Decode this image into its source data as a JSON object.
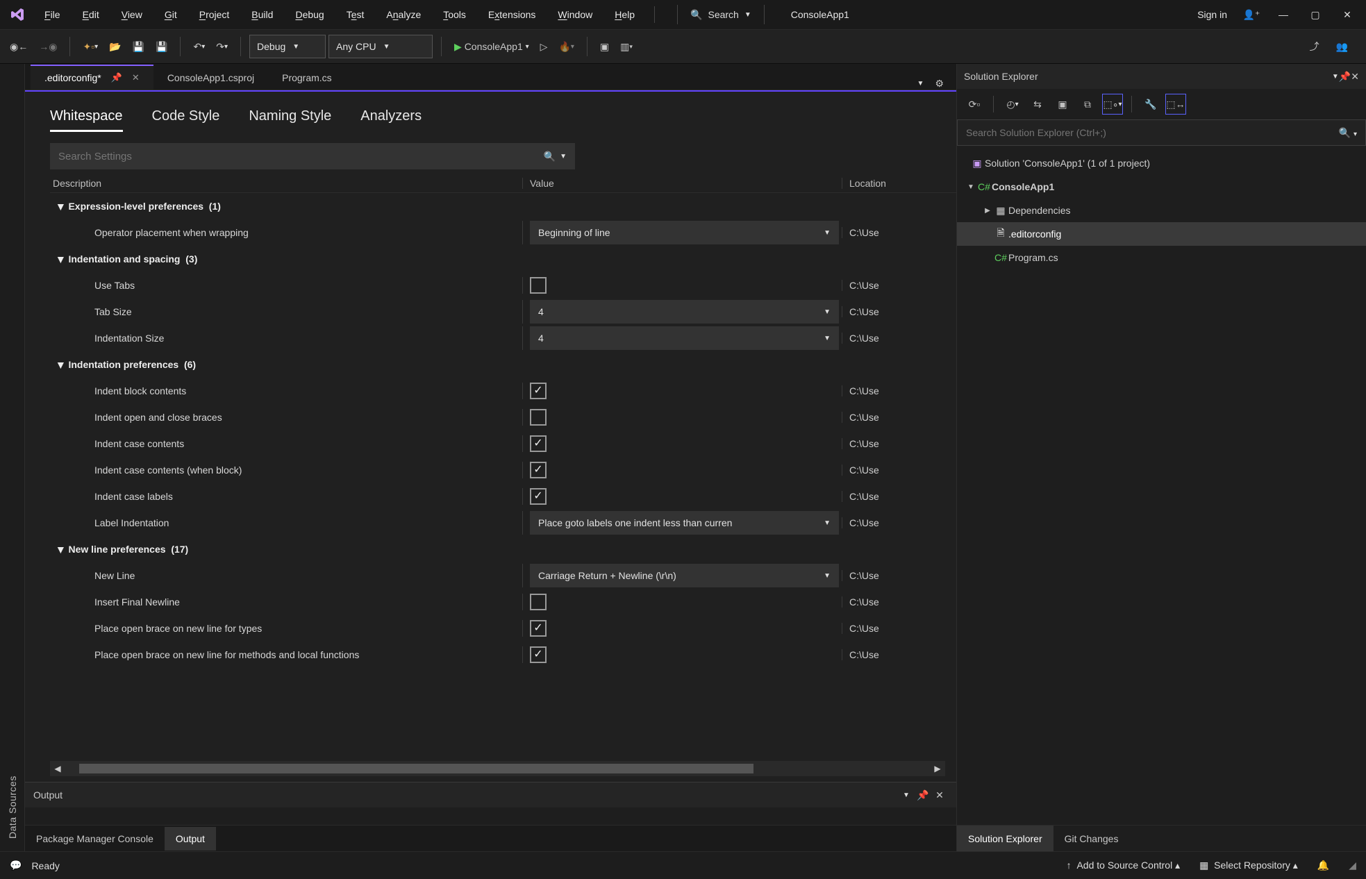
{
  "title_app": "ConsoleApp1",
  "menu": {
    "file": "File",
    "edit": "Edit",
    "view": "View",
    "git": "Git",
    "project": "Project",
    "build": "Build",
    "debug": "Debug",
    "test": "Test",
    "analyze": "Analyze",
    "tools": "Tools",
    "extensions": "Extensions",
    "window": "Window",
    "help": "Help"
  },
  "search_label": "Search",
  "signin": "Sign in",
  "toolbar": {
    "config": "Debug",
    "platform": "Any CPU",
    "start": "ConsoleApp1"
  },
  "left_pane_label": "Data Sources",
  "tabs": [
    {
      "label": ".editorconfig*",
      "active": true,
      "pinned": true,
      "closable": true
    },
    {
      "label": "ConsoleApp1.csproj",
      "active": false
    },
    {
      "label": "Program.cs",
      "active": false
    }
  ],
  "editorconfig": {
    "subtabs": [
      "Whitespace",
      "Code Style",
      "Naming Style",
      "Analyzers"
    ],
    "active_subtab": "Whitespace",
    "search_placeholder": "Search Settings",
    "columns": {
      "desc": "Description",
      "value": "Value",
      "loc": "Location"
    },
    "location_short": "C:\\Use",
    "groups": [
      {
        "title": "Expression-level preferences",
        "count": "(1)",
        "items": [
          {
            "desc": "Operator placement when wrapping",
            "kind": "dropdown",
            "value": "Beginning of line"
          }
        ]
      },
      {
        "title": "Indentation and spacing",
        "count": "(3)",
        "items": [
          {
            "desc": "Use Tabs",
            "kind": "checkbox",
            "checked": false
          },
          {
            "desc": "Tab Size",
            "kind": "dropdown",
            "value": "4"
          },
          {
            "desc": "Indentation Size",
            "kind": "dropdown",
            "value": "4"
          }
        ]
      },
      {
        "title": "Indentation preferences",
        "count": "(6)",
        "items": [
          {
            "desc": "Indent block contents",
            "kind": "checkbox",
            "checked": true
          },
          {
            "desc": "Indent open and close braces",
            "kind": "checkbox",
            "checked": false
          },
          {
            "desc": "Indent case contents",
            "kind": "checkbox",
            "checked": true
          },
          {
            "desc": "Indent case contents (when block)",
            "kind": "checkbox",
            "checked": true
          },
          {
            "desc": "Indent case labels",
            "kind": "checkbox",
            "checked": true
          },
          {
            "desc": "Label Indentation",
            "kind": "dropdown",
            "value": "Place goto labels one indent less than curren"
          }
        ]
      },
      {
        "title": "New line preferences",
        "count": "(17)",
        "items": [
          {
            "desc": "New Line",
            "kind": "dropdown",
            "value": "Carriage Return + Newline (\\r\\n)"
          },
          {
            "desc": "Insert Final Newline",
            "kind": "checkbox",
            "checked": false
          },
          {
            "desc": "Place open brace on new line for types",
            "kind": "checkbox",
            "checked": true
          },
          {
            "desc": "Place open brace on new line for methods and local functions",
            "kind": "checkbox",
            "checked": true
          }
        ]
      }
    ]
  },
  "output": {
    "title": "Output"
  },
  "bottom_tabs": [
    "Package Manager Console",
    "Output"
  ],
  "bottom_active": "Output",
  "solution": {
    "title": "Solution Explorer",
    "search_placeholder": "Search Solution Explorer (Ctrl+;)",
    "root": "Solution 'ConsoleApp1' (1 of 1 project)",
    "project": "ConsoleApp1",
    "dependencies": "Dependencies",
    "editorconfig": ".editorconfig",
    "program": "Program.cs",
    "tabs": [
      "Solution Explorer",
      "Git Changes"
    ],
    "tab_active": "Solution Explorer"
  },
  "status": {
    "ready": "Ready",
    "src": "Add to Source Control",
    "repo": "Select Repository"
  }
}
